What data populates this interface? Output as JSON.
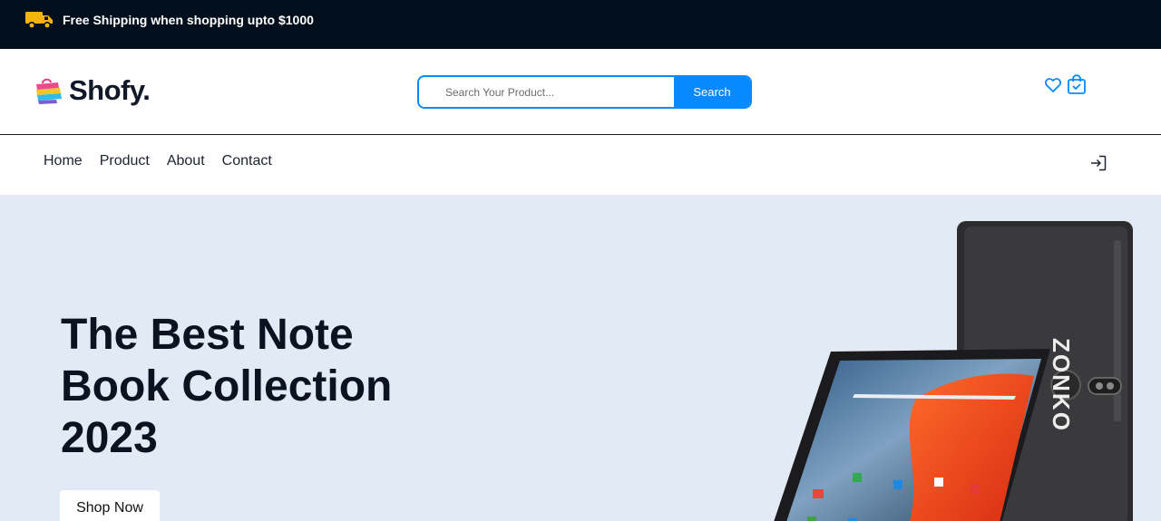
{
  "announcement": {
    "text": "Free Shipping when shopping upto $1000",
    "icon": "truck-icon",
    "icon_color": "#f5b312"
  },
  "header": {
    "logo_text": "Shofy.",
    "search": {
      "placeholder": "Search Your Product...",
      "value": "",
      "button_label": "Search"
    },
    "icons": [
      "heart-icon",
      "shopping-bag-icon"
    ],
    "accent_color": "#0989ff"
  },
  "nav": {
    "links": [
      "Home",
      "Product",
      "About",
      "Contact"
    ],
    "login_icon": "login-icon"
  },
  "hero": {
    "headline": "The Best Note Book Collection 2023",
    "cta_label": "Shop Now",
    "background": "#e2ebf5",
    "product_brand": "ZONKO"
  }
}
